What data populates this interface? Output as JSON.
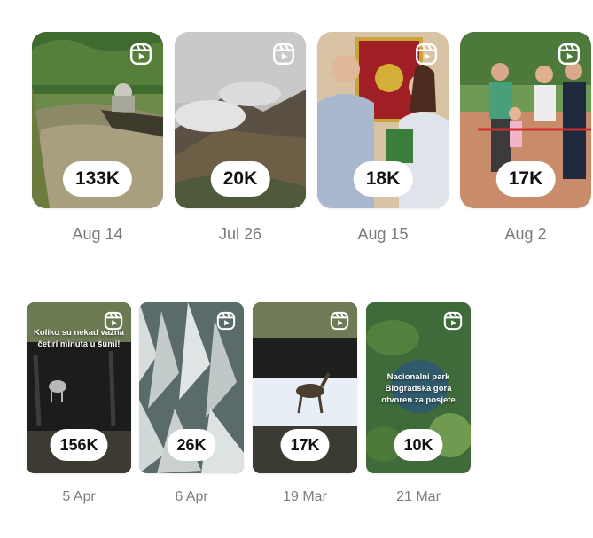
{
  "reels": [
    {
      "views": "133K",
      "date": "Aug 14",
      "icon": "reel-icon"
    },
    {
      "views": "20K",
      "date": "Jul 26",
      "icon": "reel-icon"
    },
    {
      "views": "18K",
      "date": "Aug 15",
      "icon": "reel-icon"
    },
    {
      "views": "17K",
      "date": "Aug 2",
      "icon": "reel-icon"
    },
    {
      "views": "156K",
      "date": "5 Apr",
      "icon": "reel-icon",
      "overlay": "Koliko su nekad važna četiri minuta u šumi!"
    },
    {
      "views": "26K",
      "date": "6 Apr",
      "icon": "reel-icon"
    },
    {
      "views": "17K",
      "date": "19 Mar",
      "icon": "reel-icon"
    },
    {
      "views": "10K",
      "date": "21 Mar",
      "icon": "reel-icon",
      "overlay": "Nacionalni park Biogradska gora otvoren za posjete"
    }
  ],
  "colors": {
    "view_badge_bg": "#ffffff",
    "date_text": "#7a7a7a"
  }
}
